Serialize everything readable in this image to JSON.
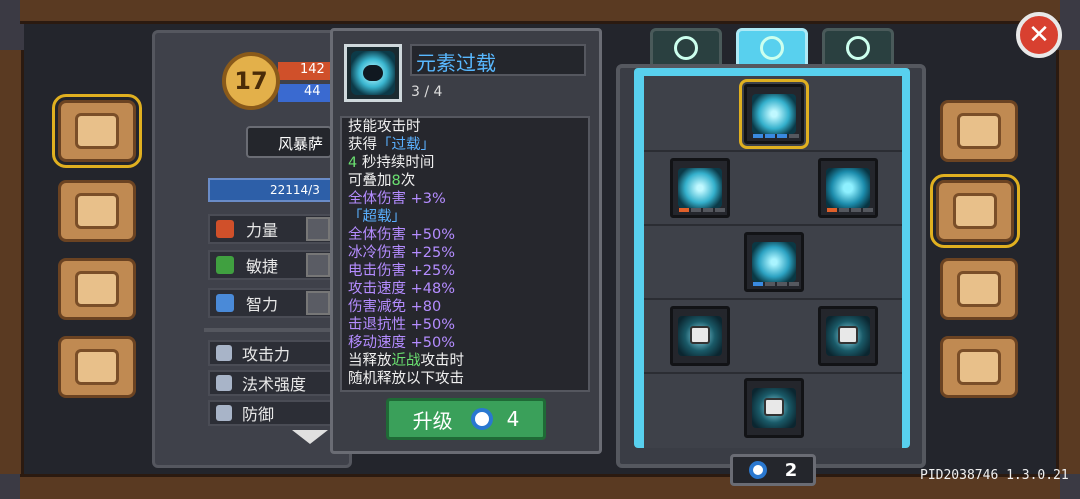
{
  "character": {
    "level": "17",
    "hp": "142",
    "mp": "44",
    "name": "风暴萨",
    "xp": "22114/3",
    "stats": [
      {
        "label": "力量",
        "icon": "strength-icon"
      },
      {
        "label": "敏捷",
        "icon": "agility-icon"
      },
      {
        "label": "智力",
        "icon": "intellect-icon"
      }
    ],
    "attributes": [
      {
        "label": "攻击力",
        "icon": "sword-icon"
      },
      {
        "label": "法术强度",
        "icon": "wand-icon"
      },
      {
        "label": "防御",
        "icon": "shield-icon"
      }
    ]
  },
  "tooltip": {
    "title": "元素过载",
    "level": "3 / 4",
    "lines": [
      {
        "text": "技能攻击时",
        "color": "white"
      },
      {
        "text": "获得「过载」",
        "color": "white",
        "highlight": "「过载」"
      },
      {
        "text": "4 秒持续时间",
        "color": "white"
      },
      {
        "text": "可叠加8次",
        "color": "white"
      },
      {
        "text": "全体伤害 +3%",
        "color": "purple"
      },
      {
        "text": "「超载」",
        "color": "blue"
      },
      {
        "text": "全体伤害 +50%",
        "color": "purple"
      },
      {
        "text": "冰冷伤害 +25%",
        "color": "purple"
      },
      {
        "text": "电击伤害 +25%",
        "color": "purple"
      },
      {
        "text": "攻击速度 +48%",
        "color": "purple"
      },
      {
        "text": "伤害减免 +80",
        "color": "purple"
      },
      {
        "text": "击退抗性 +50%",
        "color": "purple"
      },
      {
        "text": "移动速度 +50%",
        "color": "purple"
      },
      {
        "text": "当释放近战攻击时",
        "color": "white"
      },
      {
        "text": "随机释放以下攻击",
        "color": "white"
      }
    ],
    "upgrade_label": "升级",
    "upgrade_cost": "4"
  },
  "skill_tree": {
    "gems": "2",
    "tabs": [
      "tab-1",
      "tab-2",
      "tab-3"
    ]
  },
  "version": "PID2038746 1.3.0.21"
}
